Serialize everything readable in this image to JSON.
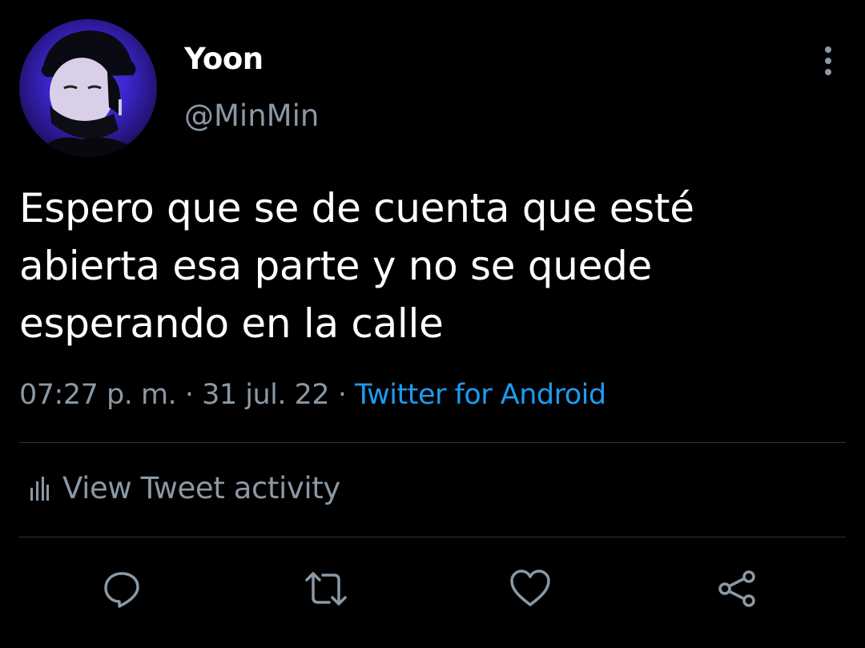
{
  "user": {
    "display_name": "Yoon",
    "handle": "@MinMin",
    "avatar_icon": "profile-photo"
  },
  "tweet": {
    "text": "Espero que se de cuenta que esté abierta esa parte y no se quede esperando en la calle",
    "time": "07:27 p. m.",
    "date": "31 jul. 22",
    "source": "Twitter for Android",
    "separator": "·"
  },
  "activity": {
    "label": "View Tweet activity",
    "icon": "bar-chart-icon"
  },
  "actions": {
    "reply_icon": "reply-icon",
    "retweet_icon": "retweet-icon",
    "like_icon": "heart-icon",
    "share_icon": "share-icon"
  },
  "colors": {
    "background": "#000000",
    "primary_text": "#ffffff",
    "secondary_text": "#8b98a5",
    "link": "#1d9bf0",
    "divider": "#2f3336"
  }
}
